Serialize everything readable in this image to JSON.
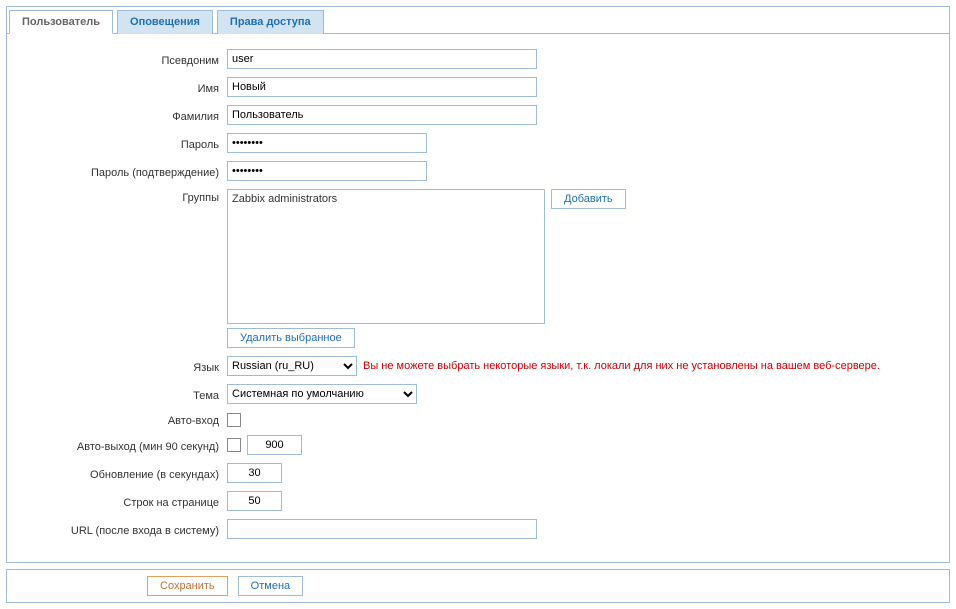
{
  "tabs": {
    "user": "Пользователь",
    "media": "Оповещения",
    "permissions": "Права доступа"
  },
  "labels": {
    "alias": "Псевдоним",
    "name": "Имя",
    "surname": "Фамилия",
    "password": "Пароль",
    "password_confirm": "Пароль (подтверждение)",
    "groups": "Группы",
    "language": "Язык",
    "theme": "Тема",
    "autologin": "Авто-вход",
    "autologout": "Авто-выход (мин 90 секунд)",
    "refresh": "Обновление (в секундах)",
    "rows": "Строк на странице",
    "url": "URL (после входа в систему)"
  },
  "values": {
    "alias": "user",
    "name": "Новый",
    "surname": "Пользователь",
    "password": "••••••••",
    "password_confirm": "••••••••",
    "group_item": "Zabbix administrators",
    "language": "Russian (ru_RU)",
    "theme": "Системная по умолчанию",
    "autologout": "900",
    "refresh": "30",
    "rows": "50",
    "url": ""
  },
  "buttons": {
    "add": "Добавить",
    "delete_selected": "Удалить выбранное",
    "save": "Сохранить",
    "cancel": "Отмена"
  },
  "messages": {
    "locale_warning": "Вы не можете выбрать некоторые языки, т.к. локали для них не установлены на вашем веб-сервере."
  }
}
